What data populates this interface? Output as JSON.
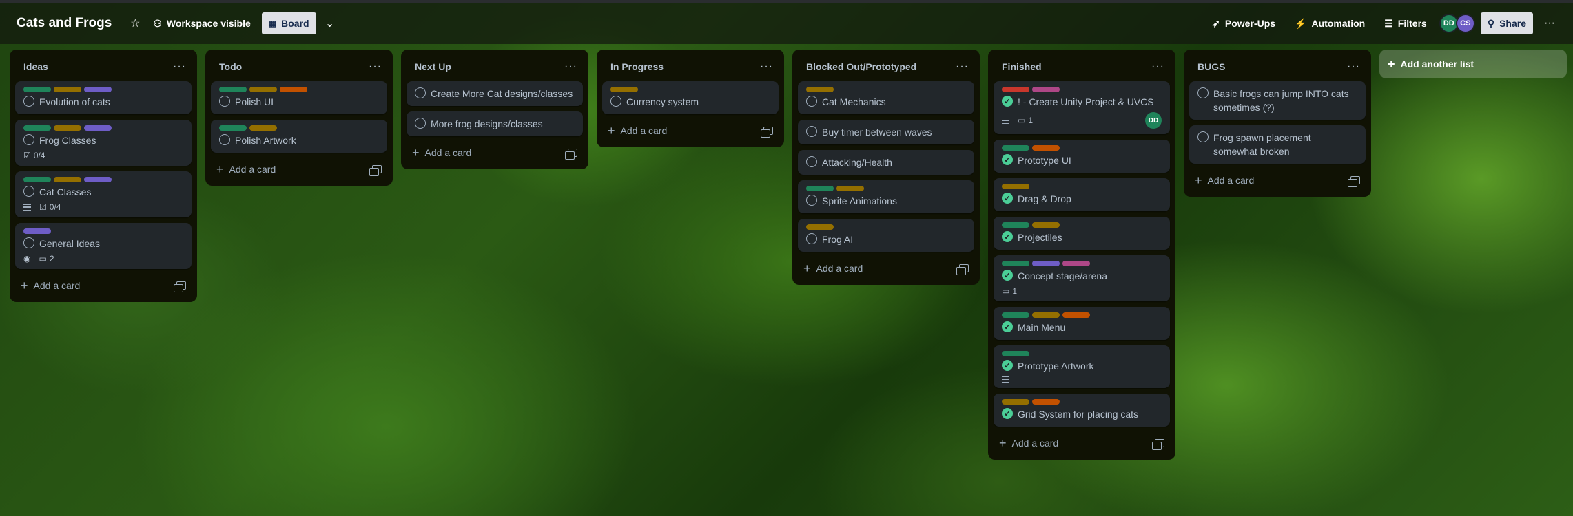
{
  "header": {
    "title": "Cats and Frogs",
    "star_icon": "star-icon",
    "visibility_label": "Workspace visible",
    "view_label": "Board",
    "powerups_label": "Power-Ups",
    "automation_label": "Automation",
    "filters_label": "Filters",
    "members": [
      {
        "initials": "DD",
        "color": "#1f845a"
      },
      {
        "initials": "CS",
        "color": "#6e5dc6"
      }
    ],
    "share_label": "Share"
  },
  "colors": {
    "green": "#1f845a",
    "yellow": "#946f00",
    "purple": "#6e5dc6",
    "orange": "#c25100",
    "red": "#c9372c",
    "pink": "#ae4787"
  },
  "add_card_label": "Add a card",
  "add_list_label": "Add another list",
  "lists": [
    {
      "title": "Ideas",
      "cards": [
        {
          "title": "Evolution of cats",
          "labels": [
            "green",
            "yellow",
            "purple"
          ],
          "done": false
        },
        {
          "title": "Frog Classes",
          "labels": [
            "green",
            "yellow",
            "purple"
          ],
          "done": false,
          "checklist": "0/4"
        },
        {
          "title": "Cat Classes",
          "labels": [
            "green",
            "yellow",
            "purple"
          ],
          "done": false,
          "description": true,
          "checklist": "0/4"
        },
        {
          "title": "General Ideas",
          "labels": [
            "purple"
          ],
          "done": false,
          "watching": true,
          "comments": "2"
        }
      ]
    },
    {
      "title": "Todo",
      "cards": [
        {
          "title": "Polish UI",
          "labels": [
            "green",
            "yellow",
            "orange"
          ],
          "done": false
        },
        {
          "title": "Polish Artwork",
          "labels": [
            "green",
            "yellow"
          ],
          "done": false
        }
      ]
    },
    {
      "title": "Next Up",
      "cards": [
        {
          "title": "Create More Cat designs/classes",
          "labels": [],
          "done": false
        },
        {
          "title": "More frog designs/classes",
          "labels": [],
          "done": false
        }
      ]
    },
    {
      "title": "In Progress",
      "cards": [
        {
          "title": "Currency system",
          "labels": [
            "yellow"
          ],
          "done": false
        }
      ]
    },
    {
      "title": "Blocked Out/Prototyped",
      "cards": [
        {
          "title": "Cat Mechanics",
          "labels": [
            "yellow"
          ],
          "done": false
        },
        {
          "title": "Buy timer between waves",
          "labels": [],
          "done": false
        },
        {
          "title": "Attacking/Health",
          "labels": [],
          "done": false
        },
        {
          "title": "Sprite Animations",
          "labels": [
            "green",
            "yellow"
          ],
          "done": false
        },
        {
          "title": "Frog AI",
          "labels": [
            "yellow"
          ],
          "done": false
        }
      ]
    },
    {
      "title": "Finished",
      "cards": [
        {
          "title": "! - Create Unity Project & UVCS",
          "labels": [
            "red",
            "pink"
          ],
          "done": true,
          "description": true,
          "comments": "1",
          "member": "DD"
        },
        {
          "title": "Prototype UI",
          "labels": [
            "green",
            "orange"
          ],
          "done": true
        },
        {
          "title": "Drag & Drop",
          "labels": [
            "yellow"
          ],
          "done": true
        },
        {
          "title": "Projectiles",
          "labels": [
            "green",
            "yellow"
          ],
          "done": true
        },
        {
          "title": "Concept stage/arena",
          "labels": [
            "green",
            "purple",
            "pink"
          ],
          "done": true,
          "comments": "1"
        },
        {
          "title": "Main Menu",
          "labels": [
            "green",
            "yellow",
            "orange"
          ],
          "done": true
        },
        {
          "title": "Prototype Artwork",
          "labels": [
            "green"
          ],
          "done": true,
          "description": true
        },
        {
          "title": "Grid System for placing cats",
          "labels": [
            "yellow",
            "orange"
          ],
          "done": true
        }
      ]
    },
    {
      "title": "BUGS",
      "cards": [
        {
          "title": "Basic frogs can jump INTO cats sometimes (?)",
          "labels": [],
          "done": false
        },
        {
          "title": "Frog spawn placement somewhat broken",
          "labels": [],
          "done": false
        }
      ]
    }
  ]
}
